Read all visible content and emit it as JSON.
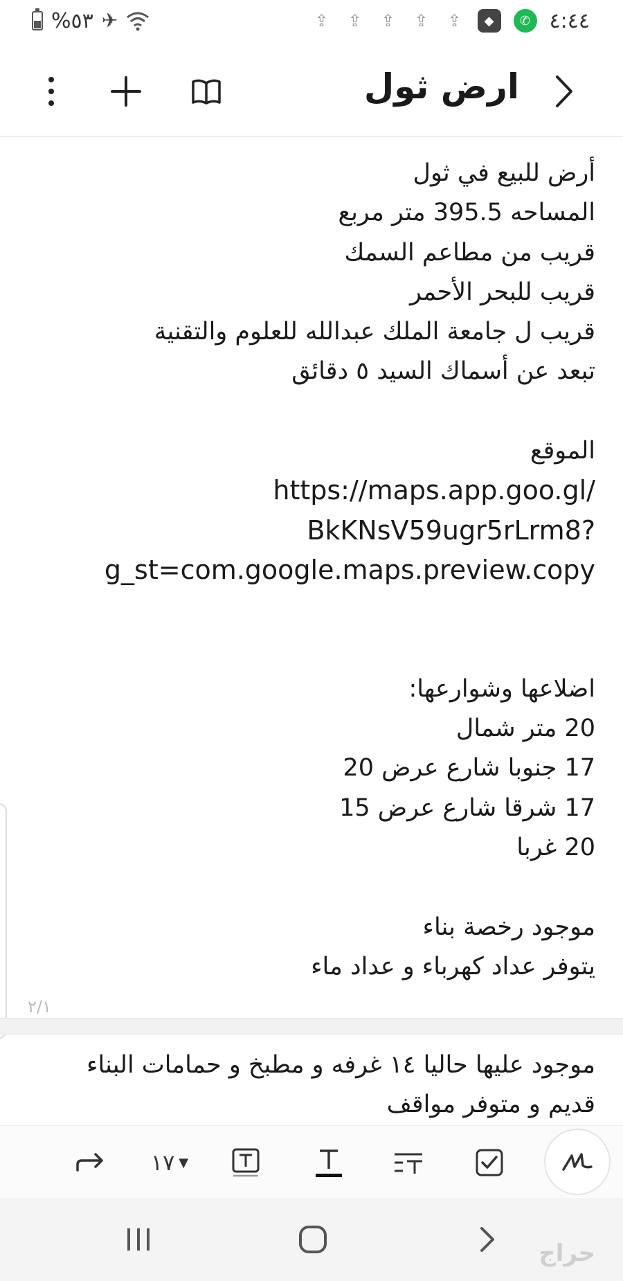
{
  "status_bar": {
    "battery": "%٥٣",
    "time": "٤:٤٤"
  },
  "header": {
    "title": "ارض ثول"
  },
  "note": {
    "lines": [
      "أرض للبيع في ثول",
      "المساحه 395.5 متر مربع",
      "قريب من مطاعم السمك",
      "قريب للبحر الأحمر",
      "قريب ل جامعة  الملك عبدالله للعلوم والتقنية",
      "تبعد عن أسماك السيد ٥ دقائق",
      "",
      "الموقع",
      "https://maps.app.goo.gl/",
      "BkKNsV59ugr5rLrm8?",
      "g_st=com.google.maps.preview.copy",
      "",
      "",
      "اضلاعها  وشوارعها:",
      "20 متر شمال",
      "17 جنوبا شارع عرض 20",
      "17 شرقا شارع عرض 15",
      "20 غربا",
      "",
      "موجود رخصة بناء",
      "يتوفر عداد كهرباء و عداد ماء"
    ],
    "page_indicator": "٢/١",
    "page2_lines": [
      "موجود عليها حاليا ١٤ غرفه و مطبخ و حمامات البناء",
      "قديم و متوفر مواقف"
    ]
  },
  "toolbar": {
    "font_size": "١٧"
  },
  "watermark": "حراج"
}
